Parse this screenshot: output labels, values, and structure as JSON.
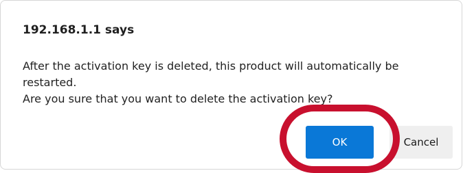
{
  "dialog": {
    "title": "192.168.1.1 says",
    "message_lines": [
      "After the activation key is deleted, this product will automatically be restarted.",
      "Are you sure that you want to delete the activation key?"
    ],
    "ok_label": "OK",
    "cancel_label": "Cancel"
  },
  "colors": {
    "ok_button": "#0a78d7",
    "cancel_button": "#efefef",
    "highlight_ring": "#c8102e"
  }
}
